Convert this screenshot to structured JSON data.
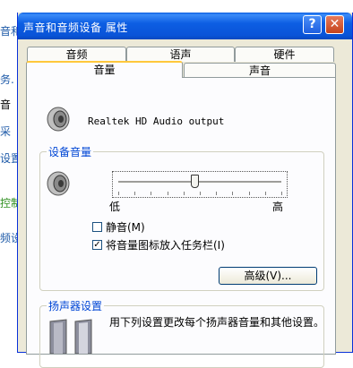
{
  "background": {
    "items": [
      {
        "text": "音和",
        "style": "blue"
      },
      {
        "text": "务.",
        "style": "blue"
      },
      {
        "text": "音",
        "style": "black"
      },
      {
        "text": "采",
        "style": "blue"
      },
      {
        "text": "设置",
        "style": "blue"
      },
      {
        "text": "控制",
        "style": "green"
      },
      {
        "text": "频设",
        "style": "blue"
      }
    ]
  },
  "window": {
    "title": "声音和音频设备 属性",
    "help_label": "?",
    "close_label": "✕"
  },
  "tabs": {
    "row1": [
      "音频",
      "语声",
      "硬件"
    ],
    "row2": [
      "音量",
      "声音"
    ],
    "selected": "音量"
  },
  "device": {
    "name": "Realtek HD Audio output",
    "icon": "speaker-icon"
  },
  "volume": {
    "section_title": "设备音量",
    "low_label": "低",
    "high_label": "高",
    "level": 0.47,
    "mute_label": "静音(M)",
    "mute_checked": false,
    "tray_label": "将音量图标放入任务栏(I)",
    "tray_checked": true,
    "advanced_button": "高级(V)..."
  },
  "speakers": {
    "section_title": "扬声器设置",
    "description": "用下列设置更改每个扬声器音量和其他设置。"
  },
  "colors": {
    "titlebar": "#0a5ce0",
    "section_title": "#0046d5",
    "tab_highlight": "#ffc83c"
  }
}
